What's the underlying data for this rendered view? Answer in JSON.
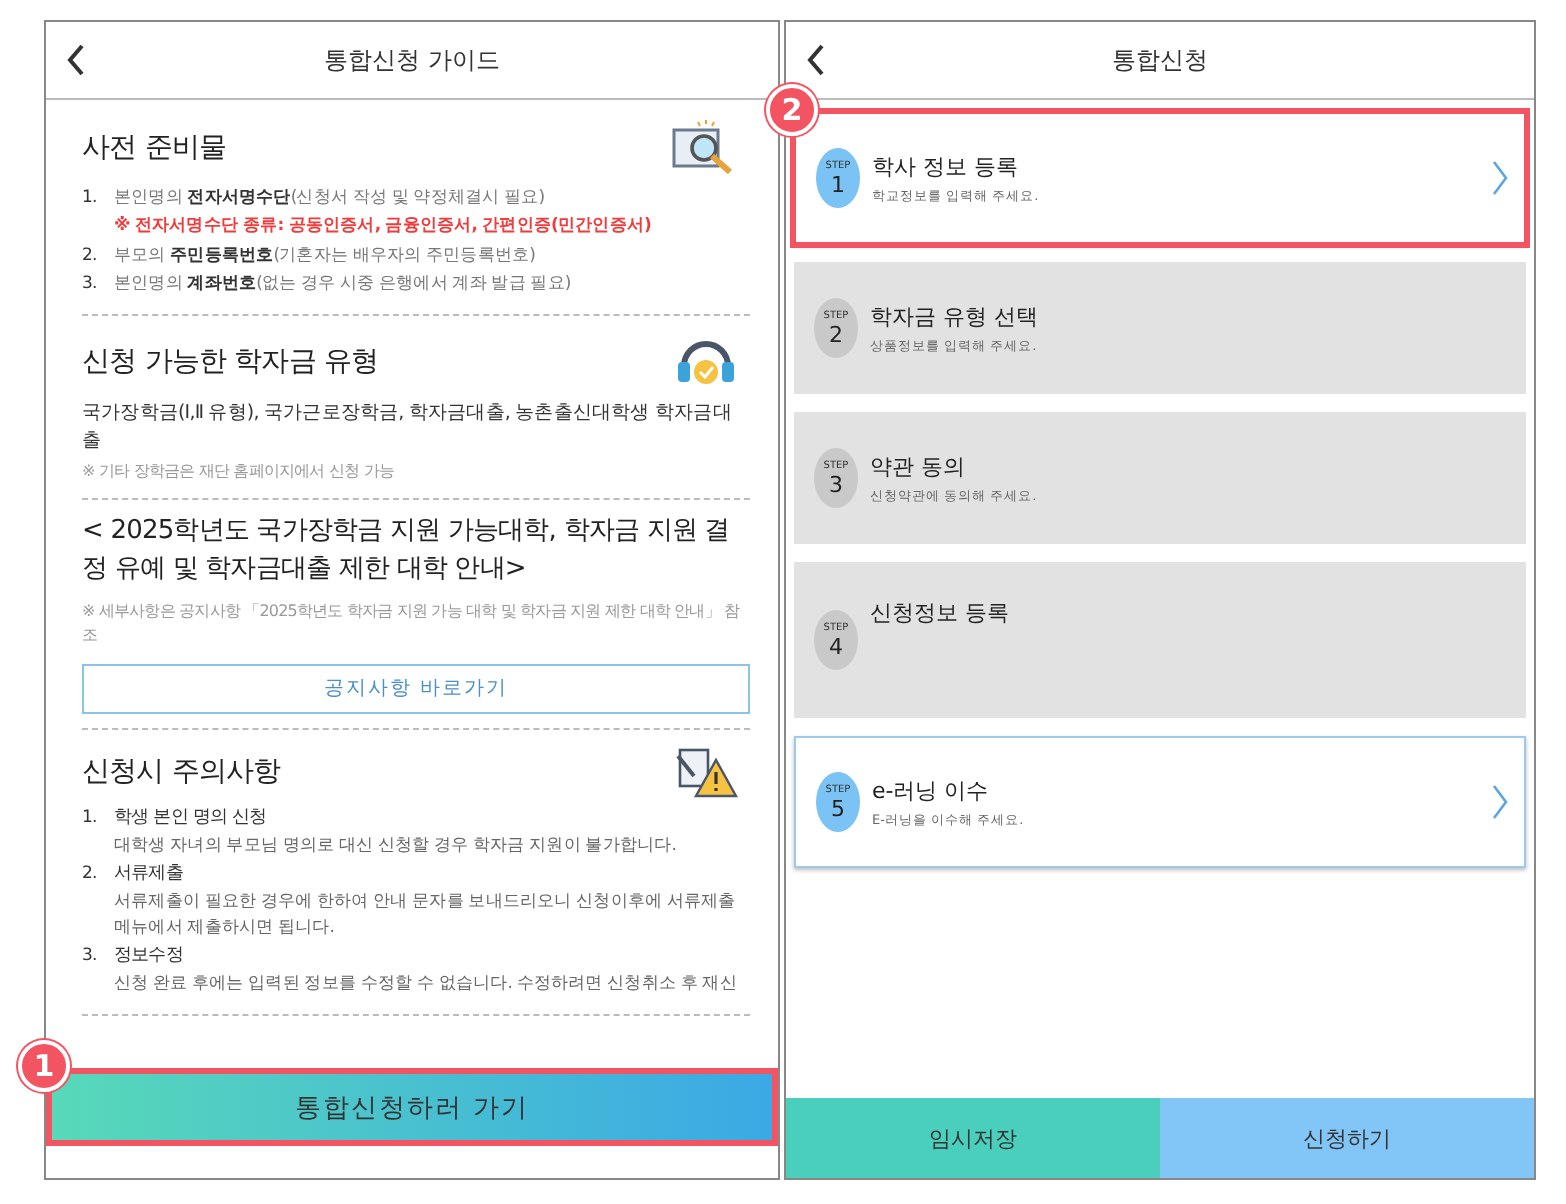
{
  "guide": {
    "title": "통합신청 가이드",
    "sections": [
      {
        "kind": "checklist",
        "title": "사전 준비물",
        "items": [
          {
            "number": "1.",
            "text": "본인명의 **전자서명수단**(신청서 작성 및 약정체결시 필요)",
            "note": "※ 전자서명수단 종류: 공동인증서, 금융인증서, 간편인증(민간인증서)"
          },
          {
            "number": "2.",
            "text": "부모의 **주민등록번호**(기혼자는 배우자의 주민등록번호)"
          },
          {
            "number": "3.",
            "text": "본인명의 **계좌번호**(없는 경우 시중 은행에서 계좌 발급 필요)"
          }
        ]
      },
      {
        "kind": "types",
        "title": "신청 가능한 학자금 유형",
        "text": "국가장학금(Ⅰ,Ⅱ 유형), 국가근로장학금, 학자금대출, 농촌출신대학생 학자금대출",
        "note": "※ 기타 장학금은 재단 홈페이지에서 신청 가능"
      },
      {
        "kind": "notice",
        "title": "< 2025학년도 국가장학금 지원 가능대학, 학자금 지원 결정 유예 및 학자금대출 제한 대학 안내>",
        "note": "※ 세부사항은 공지사항 「2025학년도 학자금 지원 가능 대학 및 학자금 지원 제한 대학 안내」 참조",
        "button": "공지사항 바로가기"
      },
      {
        "kind": "cautions",
        "title": "신청시 주의사항",
        "items": [
          {
            "number": "1.",
            "title": "학생 본인 명의 신청",
            "text": "대학생 자녀의 부모님 명의로 대신 신청할 경우 학자금 지원이 불가합니다."
          },
          {
            "number": "2.",
            "title": "서류제출",
            "text": "서류제출이 필요한 경우에 한하여 안내 문자를 보내드리오니 신청이후에 서류제출 메뉴에서 제출하시면 됩니다."
          },
          {
            "number": "3.",
            "title": "정보수정",
            "text": "신청 완료 후에는 입력된 정보를 수정할 수 없습니다. 수정하려면 신청취소 후 재신"
          }
        ]
      }
    ],
    "go_button": {
      "label": "통합신청하러 가기",
      "marker": "1"
    }
  },
  "application": {
    "title": "통합신청",
    "steps": [
      {
        "step_label": "STEP",
        "number": "1",
        "title": "학사 정보 등록",
        "subtitle": "학교정보를 입력해 주세요.",
        "enabled": true,
        "marker": "2"
      },
      {
        "step_label": "STEP",
        "number": "2",
        "title": "학자금 유형 선택",
        "subtitle": "상품정보를 입력해 주세요.",
        "enabled": false
      },
      {
        "step_label": "STEP",
        "number": "3",
        "title": "약관 동의",
        "subtitle": "신청약관에 동의해 주세요.",
        "enabled": false
      },
      {
        "step_label": "STEP",
        "number": "4",
        "title": "신청정보 등록",
        "enabled": false
      },
      {
        "step_label": "STEP",
        "number": "5",
        "title": "e-러닝 이수",
        "subtitle": "E-러닝을 이수해 주세요.",
        "enabled": true
      }
    ],
    "buttons": [
      {
        "kind": "save",
        "label": "임시저장"
      },
      {
        "kind": "submit",
        "label": "신청하기"
      }
    ]
  }
}
